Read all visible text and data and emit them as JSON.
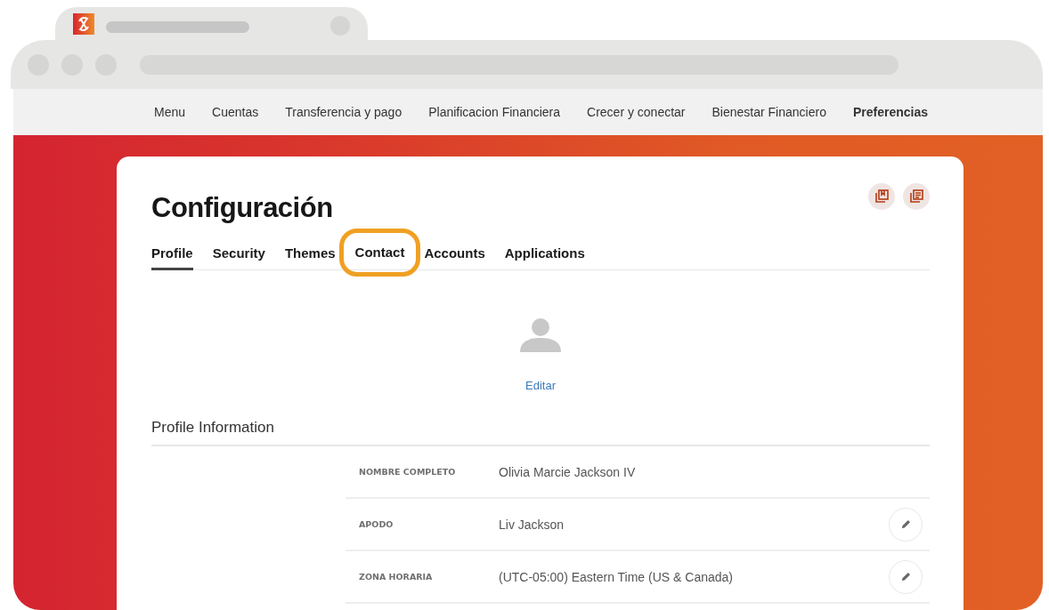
{
  "nav": [
    {
      "label": "Menu",
      "selected": false
    },
    {
      "label": "Cuentas",
      "selected": false
    },
    {
      "label": "Transferencia y pago",
      "selected": false
    },
    {
      "label": "Planificacion Financiera",
      "selected": false
    },
    {
      "label": "Crecer y conectar",
      "selected": false
    },
    {
      "label": "Bienestar Financiero",
      "selected": false
    },
    {
      "label": "Preferencias",
      "selected": true
    }
  ],
  "title": "Configuración",
  "tabs": [
    {
      "label": "Profile",
      "selected": true,
      "highlighted": false
    },
    {
      "label": "Security",
      "selected": false,
      "highlighted": false
    },
    {
      "label": "Themes",
      "selected": false,
      "highlighted": false
    },
    {
      "label": "Contact",
      "selected": false,
      "highlighted": true
    },
    {
      "label": "Accounts",
      "selected": false,
      "highlighted": false
    },
    {
      "label": "Applications",
      "selected": false,
      "highlighted": false
    }
  ],
  "avatar": {
    "edit_link": "Editar"
  },
  "section_title": "Profile Information",
  "fields": [
    {
      "label": "NOMBRE COMPLETO",
      "value": "Olivia Marcie Jackson IV",
      "editable": false
    },
    {
      "label": "APODO",
      "value": "Liv Jackson",
      "editable": true
    },
    {
      "label": "ZONA HORARIA",
      "value": "(UTC-05:00) Eastern Time (US & Canada)",
      "editable": true
    }
  ]
}
